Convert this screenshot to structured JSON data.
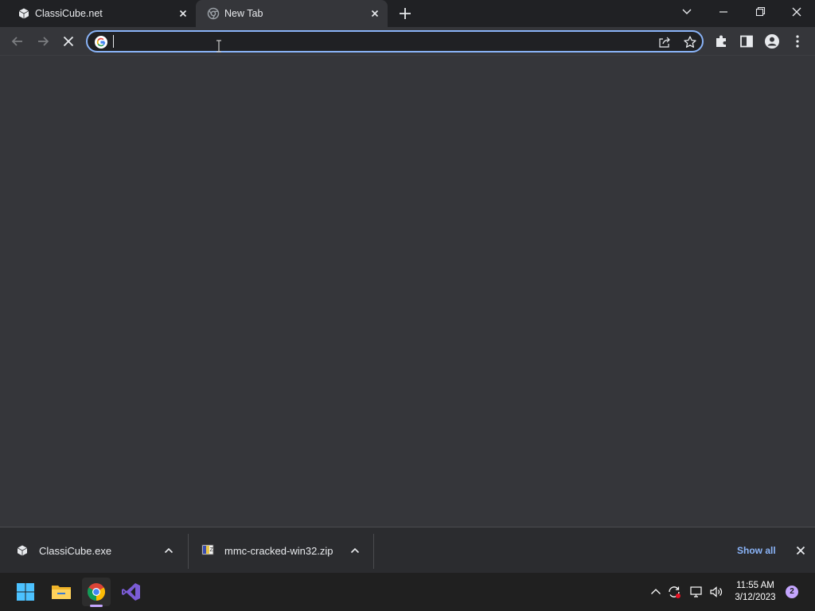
{
  "tabs": [
    {
      "title": "ClassiCube.net",
      "favicon": "cube-icon",
      "active": false
    },
    {
      "title": "New Tab",
      "favicon": "chrome-newtab-icon",
      "active": true
    }
  ],
  "omnibox": {
    "value": "",
    "placeholder": ""
  },
  "downloads": [
    {
      "name": "ClassiCube.exe",
      "icon": "cube-icon"
    },
    {
      "name": "mmc-cracked-win32.zip",
      "icon": "zip-archive-icon"
    }
  ],
  "shelf": {
    "show_all": "Show all"
  },
  "clock": {
    "time": "11:55 AM",
    "date": "3/12/2023"
  },
  "notifications": {
    "count": "2"
  },
  "colors": {
    "accent": "#8ab4f8",
    "page_bg": "#35363a",
    "tabstrip_bg": "#202124",
    "taskbar_bg": "#202020",
    "badge": "#c5a6ff"
  }
}
